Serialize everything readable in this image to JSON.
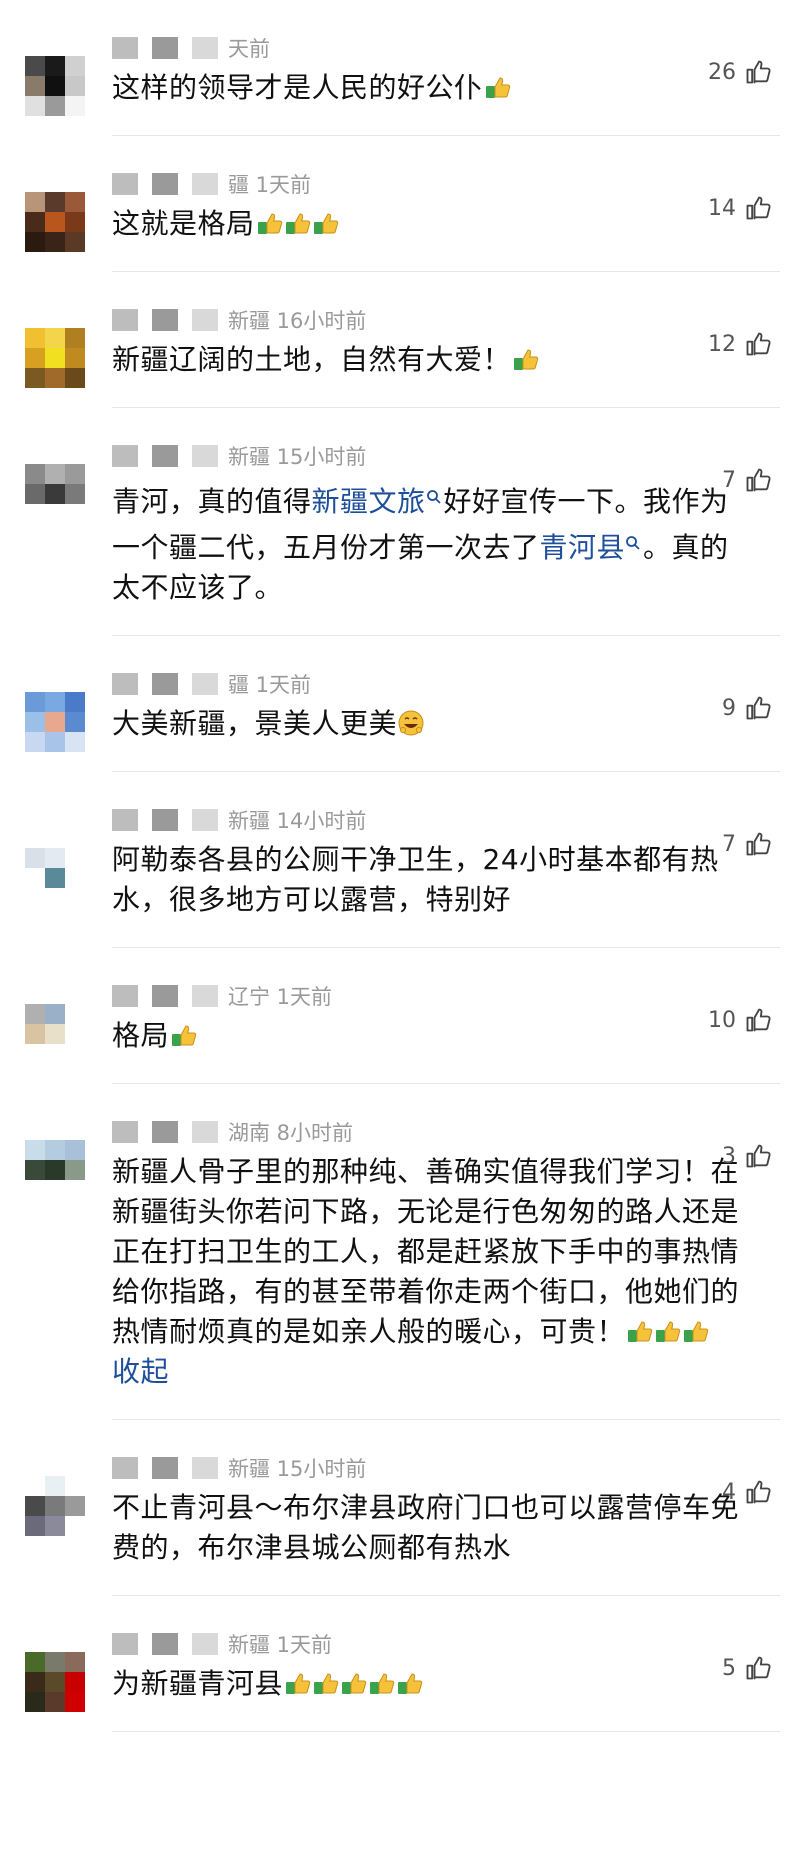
{
  "comments": [
    {
      "meta": "天前",
      "likes": "26",
      "text_before": "这样的领导才是人民的好公仆",
      "emojis": 1,
      "avatar_colors": [
        "#4a4a4a",
        "#1a1a1a",
        "#d0d0d0",
        "#8a7a6a",
        "#101010",
        "#c8c8c8",
        "#e0e0e0",
        "#9a9a9a",
        "#f4f4f4"
      ]
    },
    {
      "meta": "疆 1天前",
      "likes": "14",
      "text_before": "这就是格局",
      "emojis": 3,
      "avatar_colors": [
        "#b89478",
        "#5a3a2a",
        "#9a5a3a",
        "#4a2a1a",
        "#b8561e",
        "#7a3a1a",
        "#2a1a10",
        "#3a2418",
        "#5a3a24"
      ]
    },
    {
      "meta": "新疆 16小时前",
      "likes": "12",
      "text_before": "新疆辽阔的土地，自然有大爱！",
      "emojis": 1,
      "avatar_colors": [
        "#f0c030",
        "#f4d44a",
        "#b08020",
        "#d8a020",
        "#f0e020",
        "#c08a20",
        "#7a5a20",
        "#a06a2a",
        "#6a4a1a"
      ]
    },
    {
      "meta": "新疆 15小时前",
      "likes": "7",
      "text_parts": [
        {
          "t": "青河，真的值得"
        },
        {
          "t": "新疆文旅",
          "link": true
        },
        {
          "t": "好好宣传一下。我作为一个疆二代，五月份才第一次去了"
        },
        {
          "t": "青河县",
          "link": true
        },
        {
          "t": "。真的太不应该了。"
        }
      ],
      "emojis": 0,
      "avatar_colors": [
        "#8a8a8a",
        "#b0b0b0",
        "#9a9a9a",
        "#6a6a6a",
        "#3a3a3a",
        "#7a7a7a",
        "#ffffff",
        "#ffffff",
        "#ffffff"
      ]
    },
    {
      "meta": "疆 1天前",
      "likes": "9",
      "text_before": "大美新疆，景美人更美",
      "emojis": 0,
      "smile": true,
      "avatar_colors": [
        "#6a9ad8",
        "#7aa8e0",
        "#4a7ac8",
        "#9ac0e8",
        "#e8a890",
        "#5a8ad0",
        "#c8d8f0",
        "#a8c4e8",
        "#d8e4f4"
      ]
    },
    {
      "meta": "新疆 14小时前",
      "likes": "7",
      "text_before": "阿勒泰各县的公厕干净卫生，24小时基本都有热水，很多地方可以露营，特别好",
      "emojis": 0,
      "avatar_colors": [
        "#ffffff",
        "#ffffff",
        "#ffffff",
        "#d8e0ea",
        "#e4eaf2",
        "#ffffff",
        "#ffffff",
        "#5a8a9a",
        "#ffffff"
      ]
    },
    {
      "meta": "辽宁 1天前",
      "likes": "10",
      "text_before": "格局",
      "emojis": 1,
      "avatar_colors": [
        "#b0b0b0",
        "#9ab0c8",
        "#ffffff",
        "#d8c4a0",
        "#e8e0c8",
        "#ffffff",
        "#ffffff",
        "#ffffff",
        "#ffffff"
      ]
    },
    {
      "meta": "湖南 8小时前",
      "likes": "3",
      "text_before": "新疆人骨子里的那种纯、善确实值得我们学习！在新疆街头你若问下路，无论是行色匆匆的路人还是正在打扫卫生的工人，都是赶紧放下手中的事热情给你指路，有的甚至带着你走两个街口，他她们的热情耐烦真的是如亲人般的暖心，可贵！",
      "emojis": 3,
      "collapse": "收起",
      "avatar_colors": [
        "#c8dcea",
        "#b4cce0",
        "#a8c0d8",
        "#3a4a3a",
        "#2a3a2a",
        "#8a9a8a",
        "#ffffff",
        "#ffffff",
        "#ffffff"
      ]
    },
    {
      "meta": "新疆 15小时前",
      "likes": "4",
      "text_before": "不止青河县～布尔津县政府门口也可以露营停车免费的，布尔津县城公厕都有热水",
      "emojis": 0,
      "avatar_colors": [
        "#ffffff",
        "#e8f0f4",
        "#ffffff",
        "#4a4a4a",
        "#7a7a7a",
        "#9a9a9a",
        "#6a6a7a",
        "#8a8a9a",
        "#ffffff"
      ]
    },
    {
      "meta": "新疆 1天前",
      "likes": "5",
      "text_before": "为新疆青河县",
      "emojis": 5,
      "avatar_colors": [
        "#4a6a2a",
        "#7a7a6a",
        "#8a6a5a",
        "#3a2a1a",
        "#5a4a2a",
        "#c80000",
        "#2a2a1a",
        "#5a3a2a",
        "#d00000"
      ]
    }
  ]
}
